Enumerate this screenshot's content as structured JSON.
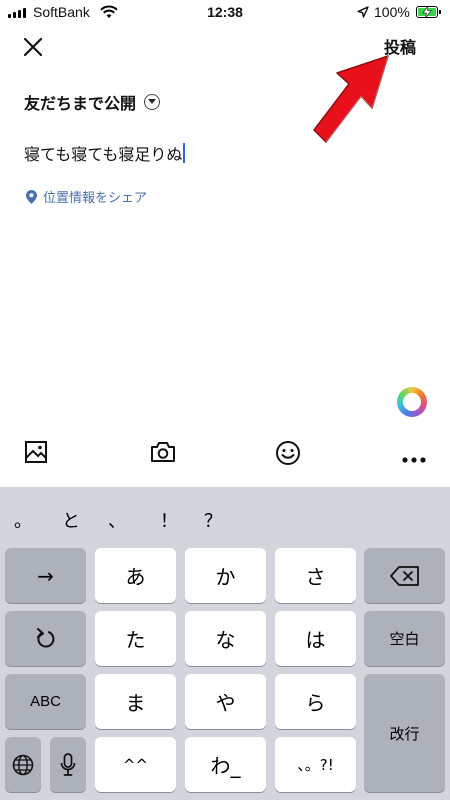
{
  "status_bar": {
    "carrier": "SoftBank",
    "time": "12:38",
    "battery": "100%"
  },
  "header": {
    "post_label": "投稿"
  },
  "privacy": {
    "label": "友だちまで公開"
  },
  "post": {
    "text": "寝ても寝ても寝足りぬ"
  },
  "location": {
    "label": "位置情報をシェア"
  },
  "keyboard": {
    "suggestions": [
      "。",
      "と",
      "、",
      "！",
      "？"
    ],
    "row1": [
      "→",
      "あ",
      "か",
      "さ"
    ],
    "row2": [
      "↺",
      "た",
      "な",
      "は",
      "空白"
    ],
    "row3": [
      "ABC",
      "ま",
      "や",
      "ら",
      "改行"
    ],
    "row4": [
      "^^",
      "わ_",
      "、。?!"
    ]
  },
  "colors": {
    "accent": "#2b63e8",
    "link": "#4a6fb3",
    "keyboard_bg": "#d2d5db"
  }
}
